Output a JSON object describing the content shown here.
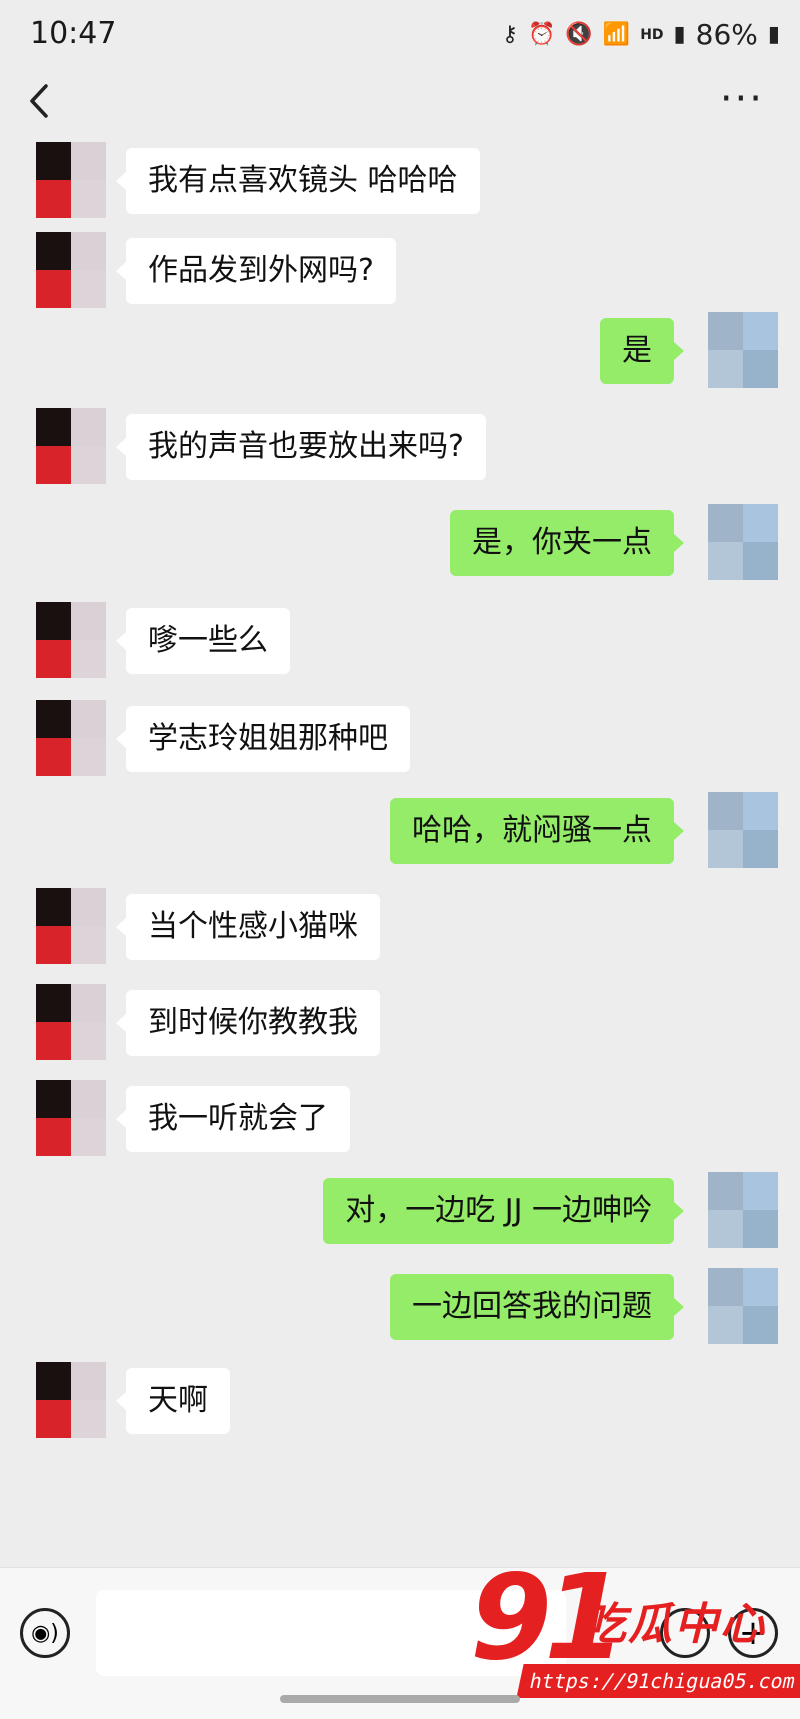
{
  "status": {
    "time": "10:47",
    "battery": "86%",
    "network": "HD"
  },
  "topbar": {
    "back_icon": "chevron-left-icon",
    "more_label": "···"
  },
  "messages": [
    {
      "side": "in",
      "text": "我有点喜欢镜头 哈哈哈"
    },
    {
      "side": "in",
      "text": "作品发到外网吗?"
    },
    {
      "side": "out",
      "text": "是"
    },
    {
      "side": "in",
      "text": "我的声音也要放出来吗?"
    },
    {
      "side": "out",
      "text": "是，你夹一点"
    },
    {
      "side": "in",
      "text": "嗲一些么"
    },
    {
      "side": "in",
      "text": "学志玲姐姐那种吧"
    },
    {
      "side": "out",
      "text": "哈哈，就闷骚一点"
    },
    {
      "side": "in",
      "text": "当个性感小猫咪"
    },
    {
      "side": "in",
      "text": "到时候你教教我"
    },
    {
      "side": "in",
      "text": "我一听就会了"
    },
    {
      "side": "out",
      "text": "对，一边吃 JJ 一边呻吟"
    },
    {
      "side": "out",
      "text": "一边回答我的问题"
    },
    {
      "side": "in",
      "text": "天啊"
    }
  ],
  "colors": {
    "incoming_bubble": "#ffffff",
    "outgoing_bubble": "#95ec69",
    "avatar_left": [
      "#1a1010",
      "#d9d1d6",
      "#d8232a",
      "#ddd4da"
    ],
    "avatar_right": [
      "#9fb4c8",
      "#a9c4de",
      "#b3c6d8",
      "#97b3cc"
    ]
  },
  "input": {
    "placeholder": ""
  },
  "watermark": {
    "number": "91",
    "text": "吃瓜中心",
    "url": "https://91chigua05.com"
  }
}
